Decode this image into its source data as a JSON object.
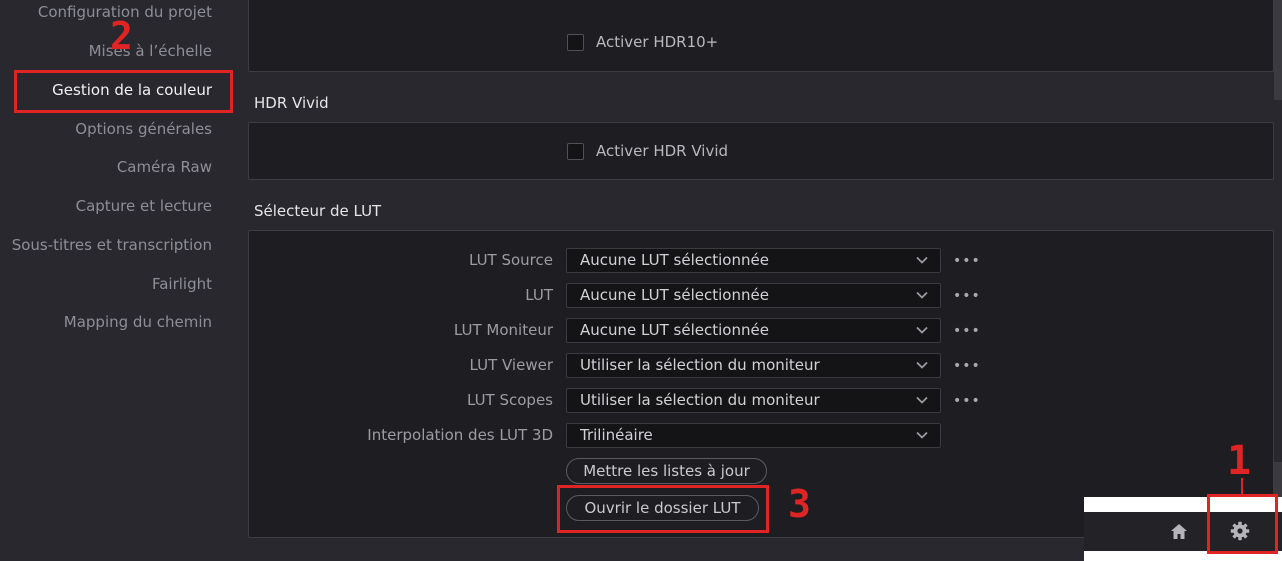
{
  "sidebar": {
    "items": [
      {
        "label": "Configuration du projet"
      },
      {
        "label": "Mises à l’échelle"
      },
      {
        "label": "Gestion de la couleur"
      },
      {
        "label": "Options générales"
      },
      {
        "label": "Caméra Raw"
      },
      {
        "label": "Capture et lecture"
      },
      {
        "label": "Sous-titres et transcription"
      },
      {
        "label": "Fairlight"
      },
      {
        "label": "Mapping du chemin"
      }
    ],
    "active_index": 2
  },
  "hdr10plus": {
    "checkbox_label": "Activer HDR10+",
    "checked": false
  },
  "hdr_vivid": {
    "title": "HDR Vivid",
    "checkbox_label": "Activer HDR Vivid",
    "checked": false
  },
  "lut_selector": {
    "title": "Sélecteur de LUT",
    "rows": [
      {
        "label": "LUT Source",
        "value": "Aucune LUT sélectionnée",
        "has_more": true
      },
      {
        "label": "LUT",
        "value": "Aucune LUT sélectionnée",
        "has_more": true
      },
      {
        "label": "LUT Moniteur",
        "value": "Aucune LUT sélectionnée",
        "has_more": true
      },
      {
        "label": "LUT Viewer",
        "value": "Utiliser la sélection du moniteur",
        "has_more": true
      },
      {
        "label": "LUT Scopes",
        "value": "Utiliser la sélection du moniteur",
        "has_more": true
      },
      {
        "label": "Interpolation des LUT 3D",
        "value": "Trilinéaire",
        "has_more": false
      }
    ],
    "more_glyph": "•••",
    "update_button": "Mettre les listes à jour",
    "open_folder_button": "Ouvrir le dossier LUT"
  },
  "annotations": {
    "step1": "1",
    "step2": "2",
    "step3": "3"
  },
  "bottom_bar": {
    "icons": [
      "home-icon",
      "gear-icon"
    ]
  },
  "colors": {
    "highlight": "#e02424",
    "background": "#28282e",
    "panel": "#1e1e22"
  }
}
